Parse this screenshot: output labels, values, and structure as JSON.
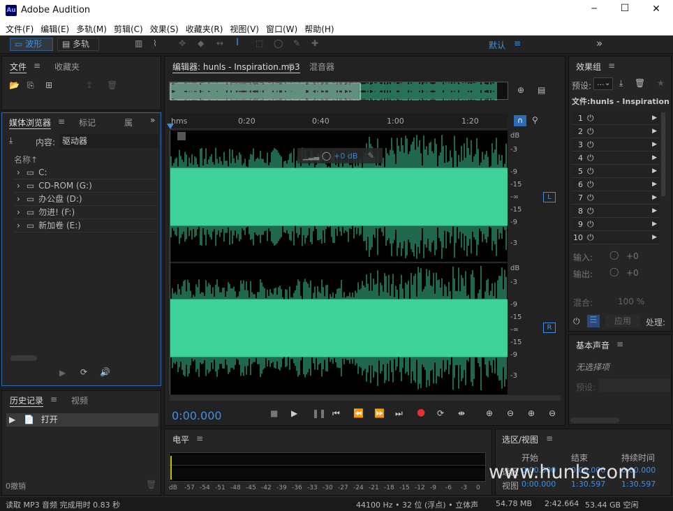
{
  "app": {
    "title": "Adobe Audition",
    "logo": "Au"
  },
  "window_controls": {
    "minimize": "─",
    "maximize": "☐",
    "close": "✕"
  },
  "menu": [
    "文件(F)",
    "编辑(E)",
    "多轨(M)",
    "剪辑(C)",
    "效果(S)",
    "收藏夹(R)",
    "视图(V)",
    "窗口(W)",
    "帮助(H)"
  ],
  "toolbar": {
    "waveform_label": "波形",
    "multitrack_label": "多轨",
    "workspace_label": "默认",
    "more": "»"
  },
  "files_panel": {
    "tabs": [
      "文件",
      "收藏夹"
    ]
  },
  "media_browser": {
    "tabs": [
      "媒体浏览器",
      "标记",
      "属"
    ],
    "content_label": "内容:",
    "content_value": "驱动器",
    "name_header": "名称",
    "drives": [
      "C:",
      "CD-ROM (G:)",
      "办公盘 (D:)",
      "勿进!  (F:)",
      "新加卷 (E:)"
    ]
  },
  "history_panel": {
    "tabs": [
      "历史记录",
      "视频"
    ],
    "items": [
      "打开"
    ],
    "undo_count": "0撤销"
  },
  "editor": {
    "tab_label": "编辑器: hunls - Inspiration.mp3",
    "mixer_tab": "混音器",
    "time_marks": [
      "hms",
      "0:20",
      "0:40",
      "1:00",
      "1:20"
    ],
    "db_labels_top": [
      "dB",
      "-3",
      "-9",
      "-15",
      "-∞",
      "-15",
      "-9",
      "-3"
    ],
    "db_labels_bottom": [
      "dB",
      "-3",
      "-9",
      "-15",
      "-∞",
      "-15",
      "-9",
      "-3"
    ],
    "channel_left": "L",
    "channel_right": "R",
    "hud_value": "+0 dB",
    "current_time": "0:00.000",
    "waveform_color": "#3fd19a"
  },
  "effects_rack": {
    "tab": "效果组",
    "preset_label": "预设:",
    "preset_value": "...",
    "file_label": "文件:hunls - Inspiration...",
    "slots": [
      "1",
      "2",
      "3",
      "4",
      "5",
      "6",
      "7",
      "8",
      "9",
      "10"
    ],
    "input_label": "输入:",
    "input_value": "+0",
    "output_label": "输出:",
    "output_value": "+0",
    "mix_label": "混合:",
    "mix_value": "100 %",
    "apply_label": "应用",
    "process_label": "处理:"
  },
  "essential_sound": {
    "tab": "基本声音",
    "no_selection": "无选择项",
    "preset_label": "预设:"
  },
  "level_panel": {
    "tab": "电平",
    "scale": [
      "dB",
      "-57",
      "-54",
      "-51",
      "-48",
      "-45",
      "-42",
      "-39",
      "-36",
      "-33",
      "-30",
      "-27",
      "-24",
      "-21",
      "-18",
      "-15",
      "-12",
      "-9",
      "-6",
      "-3",
      "0"
    ]
  },
  "selection_view": {
    "tab": "选区/视图",
    "headers": [
      "开始",
      "结束",
      "持续时间"
    ],
    "rows": [
      {
        "label": "选区",
        "start": "0:00.000",
        "end": "0:00.000",
        "duration": "0:00.000"
      },
      {
        "label": "视图",
        "start": "0:00.000",
        "end": "1:30.597",
        "duration": "1:30.597"
      }
    ],
    "watermark": "www.hunls.com"
  },
  "status": {
    "message": "读取 MP3 音频 完成用时 0.83 秒",
    "format": "44100 Hz • 32 位 (浮点) • 立体声",
    "size": "54.78 MB",
    "duration": "2:42.664",
    "free": "53.44 GB 空闲"
  }
}
